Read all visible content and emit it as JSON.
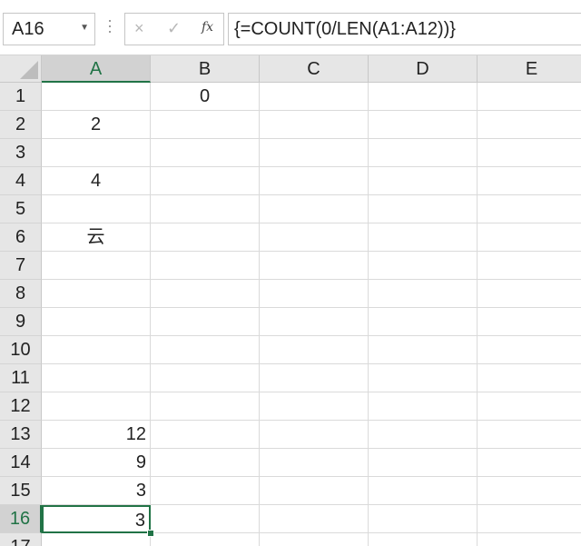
{
  "formula_bar": {
    "name_box": "A16",
    "cancel_icon": "×",
    "enter_icon": "✓",
    "fx_label": "fx",
    "formula": "{=COUNT(0/LEN(A1:A12))}"
  },
  "columns": [
    "A",
    "B",
    "C",
    "D",
    "E"
  ],
  "rows": [
    "1",
    "2",
    "3",
    "4",
    "5",
    "6",
    "7",
    "8",
    "9",
    "10",
    "11",
    "12",
    "13",
    "14",
    "15",
    "16",
    "17"
  ],
  "cells": {
    "B1": "0",
    "A2": "2",
    "A4": "4",
    "A6": "云",
    "A13": "12",
    "A14": "9",
    "A15": "3",
    "A16": "3"
  },
  "selection": {
    "column": "A",
    "row": "16"
  },
  "colors": {
    "accent": "#217346",
    "header_bg": "#e6e6e6",
    "gridline": "#dadada"
  }
}
